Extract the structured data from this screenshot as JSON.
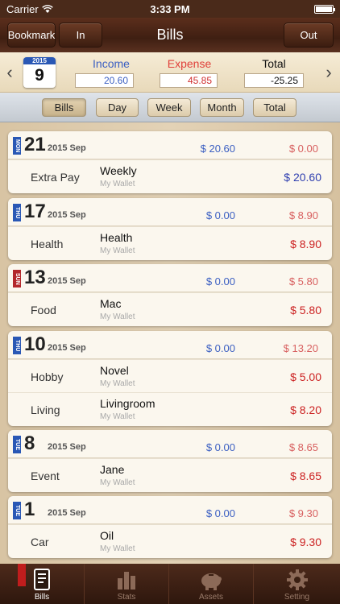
{
  "status_bar": {
    "carrier": "Carrier",
    "time": "3:33 PM"
  },
  "nav": {
    "title": "Bills",
    "bookmark_label": "Bookmark",
    "in_label": "In",
    "out_label": "Out"
  },
  "summary": {
    "calendar": {
      "year": "2015",
      "day": "9"
    },
    "income_label": "Income",
    "income_value": "20.60",
    "expense_label": "Expense",
    "expense_value": "45.85",
    "total_label": "Total",
    "total_value": "-25.25"
  },
  "segments": [
    "Bills",
    "Day",
    "Week",
    "Month",
    "Total"
  ],
  "days": [
    {
      "dow": "MON",
      "day": "21",
      "ym": "2015 Sep",
      "income": "$ 20.60",
      "expense": "$ 0.00",
      "rows": [
        {
          "category": "Extra Pay",
          "name": "Weekly",
          "wallet": "My Wallet",
          "amount": "$ 20.60",
          "kind": "inc"
        }
      ]
    },
    {
      "dow": "THU",
      "day": "17",
      "ym": "2015 Sep",
      "income": "$ 0.00",
      "expense": "$ 8.90",
      "rows": [
        {
          "category": "Health",
          "name": "Health",
          "wallet": "My Wallet",
          "amount": "$ 8.90",
          "kind": "exp"
        }
      ]
    },
    {
      "dow": "SUN",
      "day": "13",
      "ym": "2015 Sep",
      "income": "$ 0.00",
      "expense": "$ 5.80",
      "rows": [
        {
          "category": "Food",
          "name": "Mac",
          "wallet": "My Wallet",
          "amount": "$ 5.80",
          "kind": "exp"
        }
      ]
    },
    {
      "dow": "THU",
      "day": "10",
      "ym": "2015 Sep",
      "income": "$ 0.00",
      "expense": "$ 13.20",
      "rows": [
        {
          "category": "Hobby",
          "name": "Novel",
          "wallet": "My Wallet",
          "amount": "$ 5.00",
          "kind": "exp"
        },
        {
          "category": "Living",
          "name": "Livingroom",
          "wallet": "My Wallet",
          "amount": "$ 8.20",
          "kind": "exp"
        }
      ]
    },
    {
      "dow": "TUE",
      "day": "8",
      "ym": "2015 Sep",
      "income": "$ 0.00",
      "expense": "$ 8.65",
      "rows": [
        {
          "category": "Event",
          "name": "Jane",
          "wallet": "My Wallet",
          "amount": "$ 8.65",
          "kind": "exp"
        }
      ]
    },
    {
      "dow": "TUE",
      "day": "1",
      "ym": "2015 Sep",
      "income": "$ 0.00",
      "expense": "$ 9.30",
      "rows": [
        {
          "category": "Car",
          "name": "Oil",
          "wallet": "My Wallet",
          "amount": "$ 9.30",
          "kind": "exp"
        }
      ]
    }
  ],
  "tabs": [
    {
      "label": "Bills",
      "icon": "bills-icon"
    },
    {
      "label": "Stats",
      "icon": "stats-icon"
    },
    {
      "label": "Assets",
      "icon": "piggy-bank-icon"
    },
    {
      "label": "Setting",
      "icon": "gear-icon"
    }
  ],
  "colors": {
    "income": "#3040b0",
    "expense": "#cc2222",
    "nav_brown": "#4a2a1a"
  }
}
